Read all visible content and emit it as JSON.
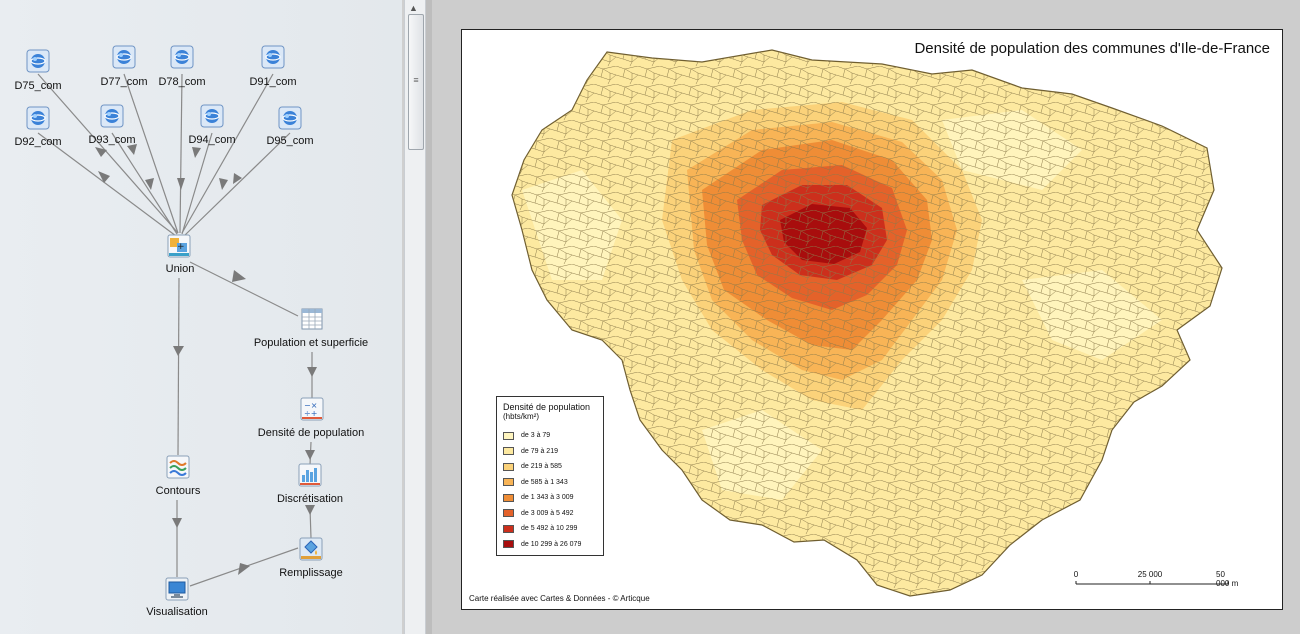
{
  "workflow": {
    "nodes": {
      "d75": "D75_com",
      "d77": "D77_com",
      "d78": "D78_com",
      "d91": "D91_com",
      "d92": "D92_com",
      "d93": "D93_com",
      "d94": "D94_com",
      "d95": "D95_com",
      "union": "Union",
      "population": "Population et superficie",
      "densite": "Densité de population",
      "discretisation": "Discrétisation",
      "contours": "Contours",
      "remplissage": "Remplissage",
      "visualisation": "Visualisation"
    }
  },
  "scrollbar": {
    "up_arrow": "▲",
    "grip": "≡"
  },
  "map": {
    "title": "Densité de population des communes d'Ile-de-France",
    "legend": {
      "title": "Densité de population",
      "unit": "(hbts/km²)",
      "classes": [
        {
          "label": "de 3 à 79",
          "color": "#fff5bf"
        },
        {
          "label": "de 79 à 219",
          "color": "#fde9a0"
        },
        {
          "label": "de 219 à 585",
          "color": "#fbd27a"
        },
        {
          "label": "de 585 à 1 343",
          "color": "#f8b456"
        },
        {
          "label": "de 1 343 à 3 009",
          "color": "#ef8d36"
        },
        {
          "label": "de 3 009 à 5 492",
          "color": "#e4622a"
        },
        {
          "label": "de 5 492 à 10 299",
          "color": "#cc2f1c"
        },
        {
          "label": "de 10 299 à 26 079",
          "color": "#a80d0d"
        }
      ]
    },
    "scale": {
      "ticks": [
        "0",
        "25 000",
        "50 000 m"
      ]
    },
    "credit": "Carte réalisée avec Cartes & Données - © Articque"
  }
}
